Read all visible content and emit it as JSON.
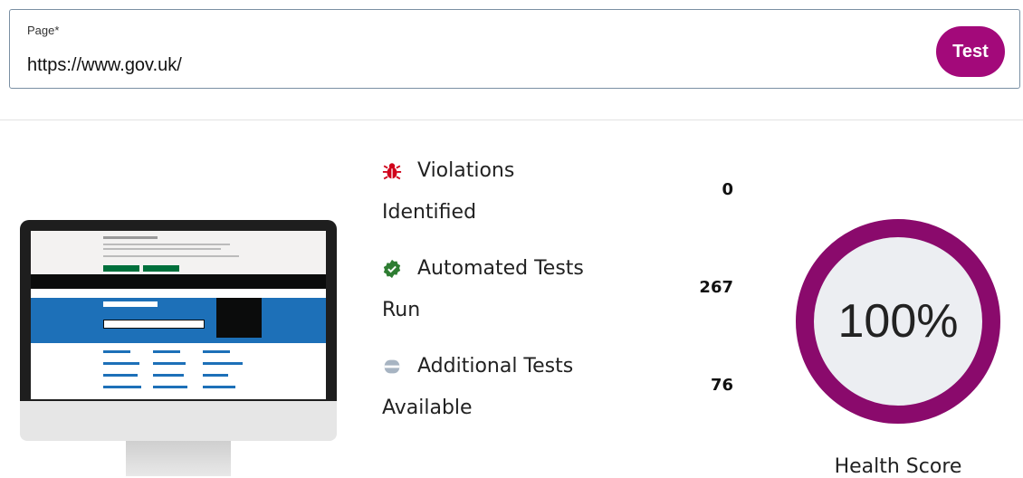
{
  "url_form": {
    "label": "Page",
    "required_mark": "*",
    "value": "https://www.gov.uk/",
    "test_label": "Test"
  },
  "stats": [
    {
      "icon": "bug-icon",
      "color": "#d0021b",
      "title": "Violations",
      "subtitle": "Identified",
      "value": "0"
    },
    {
      "icon": "verified-check-icon",
      "color": "#2e7d32",
      "title": "Automated Tests",
      "subtitle": "Run",
      "value": "267"
    },
    {
      "icon": "manual-test-icon",
      "color": "#a7b4c2",
      "title": "Additional Tests",
      "subtitle": "Available",
      "value": "76"
    }
  ],
  "health": {
    "score_text": "100%",
    "score": 100,
    "label": "Health Score",
    "ring_color": "#8a0a6c",
    "fill_color": "#eceef2"
  }
}
